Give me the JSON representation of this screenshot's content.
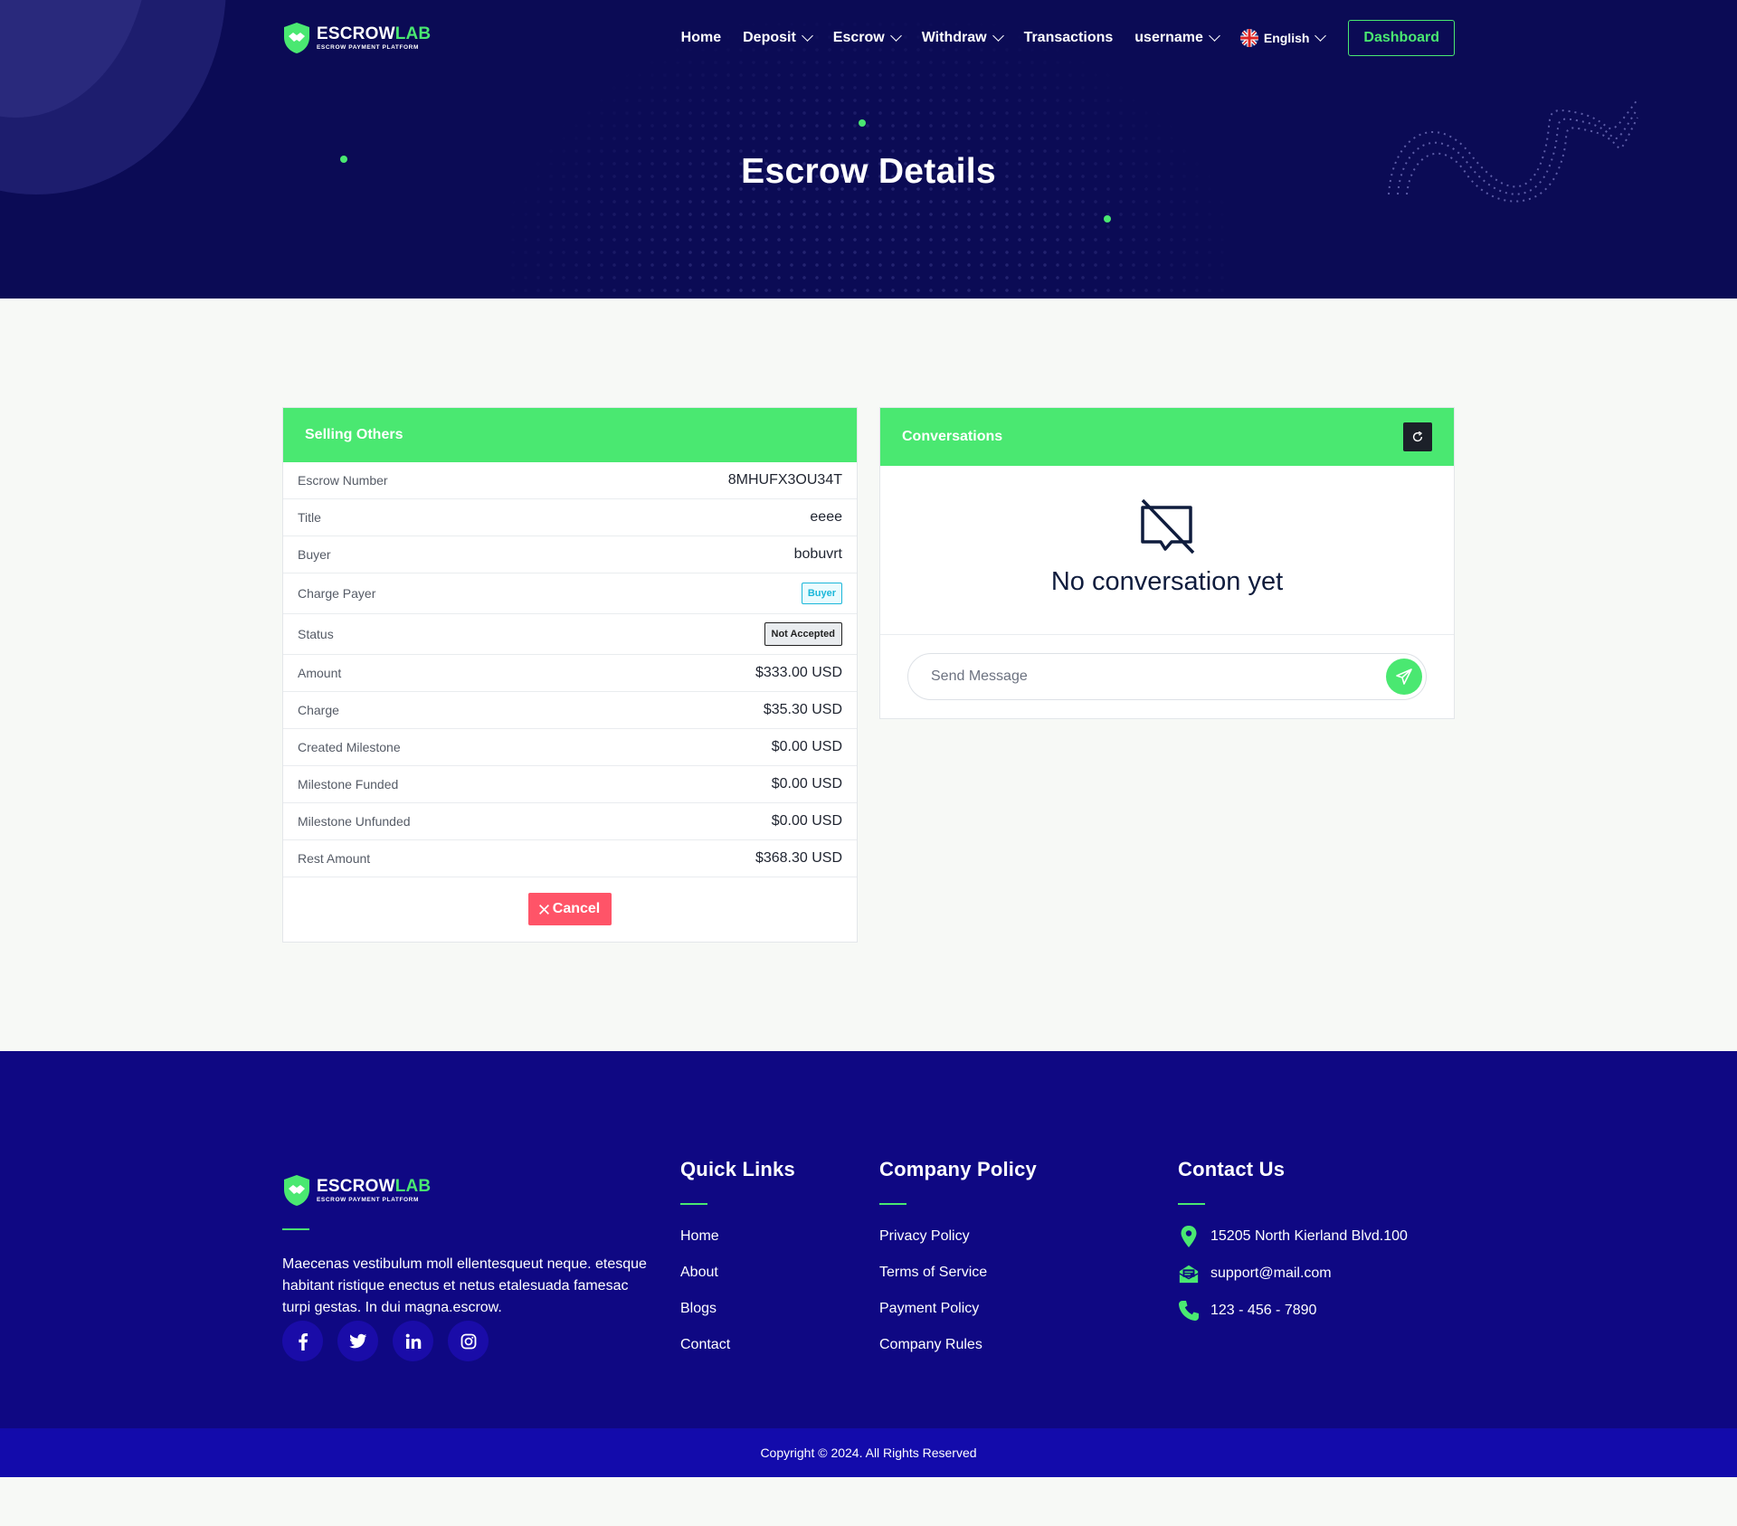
{
  "brand": {
    "name_part1": "ESCROW",
    "name_part2": "LAB",
    "tagline": "ESCROW PAYMENT PLATFORM"
  },
  "nav": {
    "items": [
      {
        "label": "Home",
        "dropdown": false
      },
      {
        "label": "Deposit",
        "dropdown": true
      },
      {
        "label": "Escrow",
        "dropdown": true
      },
      {
        "label": "Withdraw",
        "dropdown": true
      },
      {
        "label": "Transactions",
        "dropdown": false
      },
      {
        "label": "username",
        "dropdown": true
      }
    ],
    "language": "English",
    "dashboard_label": "Dashboard"
  },
  "hero": {
    "title": "Escrow Details"
  },
  "details": {
    "header": "Selling Others",
    "rows": {
      "escrow_number": {
        "label": "Escrow Number",
        "value": "8MHUFX3OU34T"
      },
      "title": {
        "label": "Title",
        "value": "eeee"
      },
      "buyer": {
        "label": "Buyer",
        "value": "bobuvrt"
      },
      "charge_payer": {
        "label": "Charge Payer",
        "value": "Buyer"
      },
      "status": {
        "label": "Status",
        "value": "Not Accepted"
      },
      "amount": {
        "label": "Amount",
        "value": "$333.00 USD"
      },
      "charge": {
        "label": "Charge",
        "value": "$35.30 USD"
      },
      "created_milestone": {
        "label": "Created Milestone",
        "value": "$0.00 USD"
      },
      "milestone_funded": {
        "label": "Milestone Funded",
        "value": "$0.00 USD"
      },
      "milestone_unfunded": {
        "label": "Milestone Unfunded",
        "value": "$0.00 USD"
      },
      "rest_amount": {
        "label": "Rest Amount",
        "value": "$368.30 USD"
      }
    },
    "cancel_label": "Cancel"
  },
  "conversations": {
    "header": "Conversations",
    "empty_text": "No conversation yet",
    "input_placeholder": "Send Message",
    "input_value": ""
  },
  "footer": {
    "about_text": "Maecenas vestibulum moll ellentesqueut neque. etesque habitant ristique enectus et netus etalesuada famesac turpi gestas. In dui magna.escrow.",
    "socials": [
      "facebook-icon",
      "twitter-icon",
      "linkedin-icon",
      "instagram-icon"
    ],
    "quick_links": {
      "title": "Quick Links",
      "items": [
        "Home",
        "About",
        "Blogs",
        "Contact"
      ]
    },
    "company_policy": {
      "title": "Company Policy",
      "items": [
        "Privacy Policy",
        "Terms of Service",
        "Payment Policy",
        "Company Rules"
      ]
    },
    "contact": {
      "title": "Contact Us",
      "address": "15205 North Kierland Blvd.100",
      "email": "support@mail.com",
      "phone": "123 - 456 - 7890"
    },
    "copyright": "Copyright © 2024. All Rights Reserved"
  },
  "colors": {
    "accent": "#4ae871",
    "hero_bg": "#0b0b55",
    "footer_bg": "#0f0883",
    "cancel": "#ff5468",
    "info": "#1bb7d9"
  }
}
